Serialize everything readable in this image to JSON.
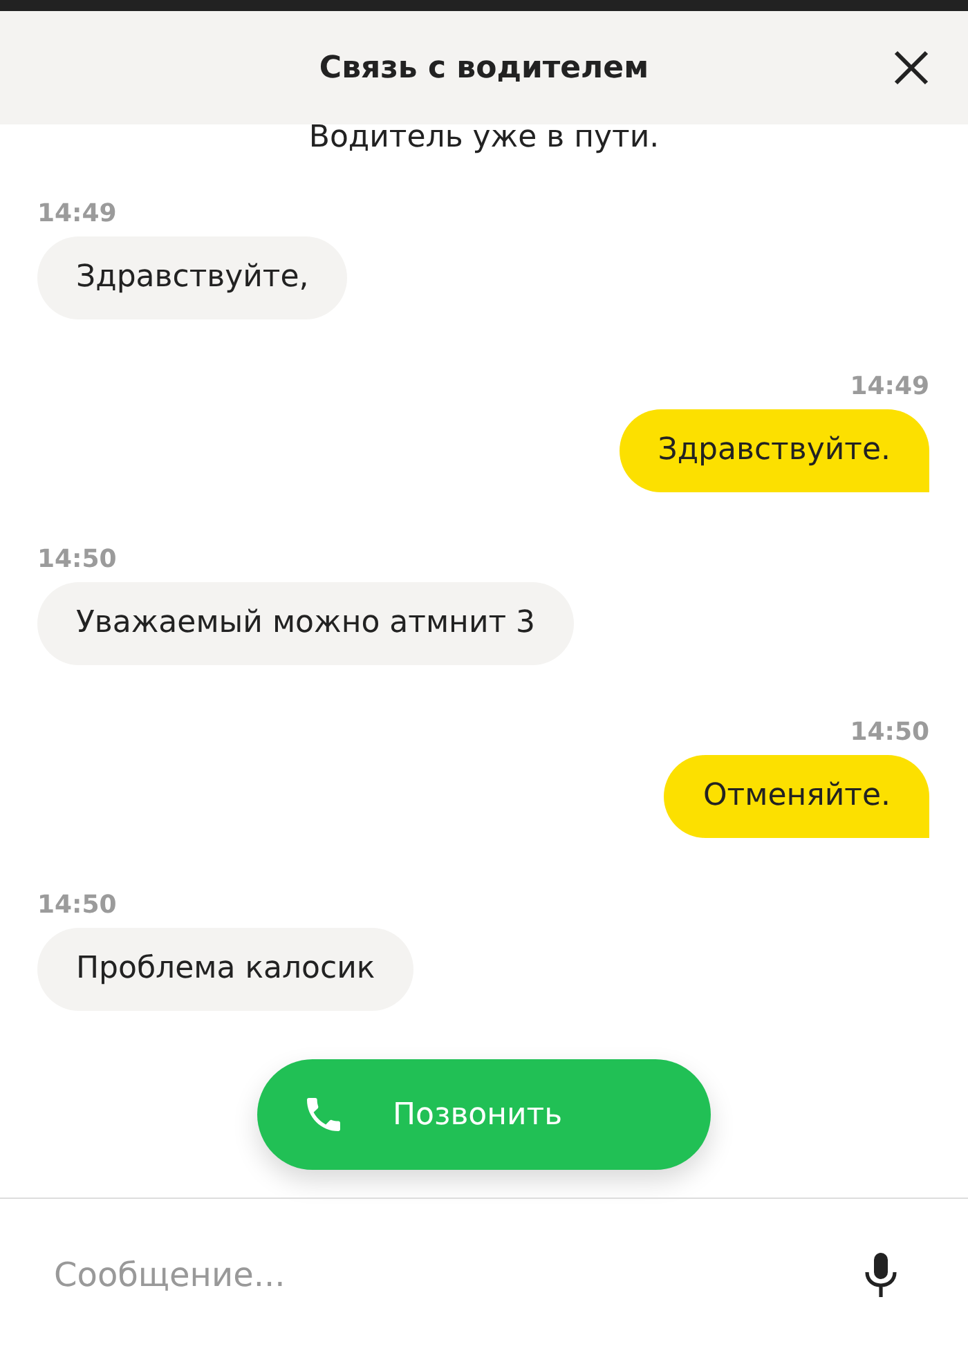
{
  "header": {
    "title": "Связь с водителем"
  },
  "status": "Водитель уже в пути.",
  "messages": [
    {
      "kind": "received",
      "time": "14:49",
      "text": "Здравствуйте,"
    },
    {
      "kind": "sent",
      "time": "14:49",
      "text": "Здравствуйте."
    },
    {
      "kind": "received",
      "time": "14:50",
      "text": "Уважаемый можно атмнит 3"
    },
    {
      "kind": "sent",
      "time": "14:50",
      "text": "Отменяйте."
    },
    {
      "kind": "received",
      "time": "14:50",
      "text": "Проблема калосик"
    }
  ],
  "call_button": {
    "label": "Позвонить"
  },
  "composer": {
    "placeholder": "Сообщение..."
  }
}
